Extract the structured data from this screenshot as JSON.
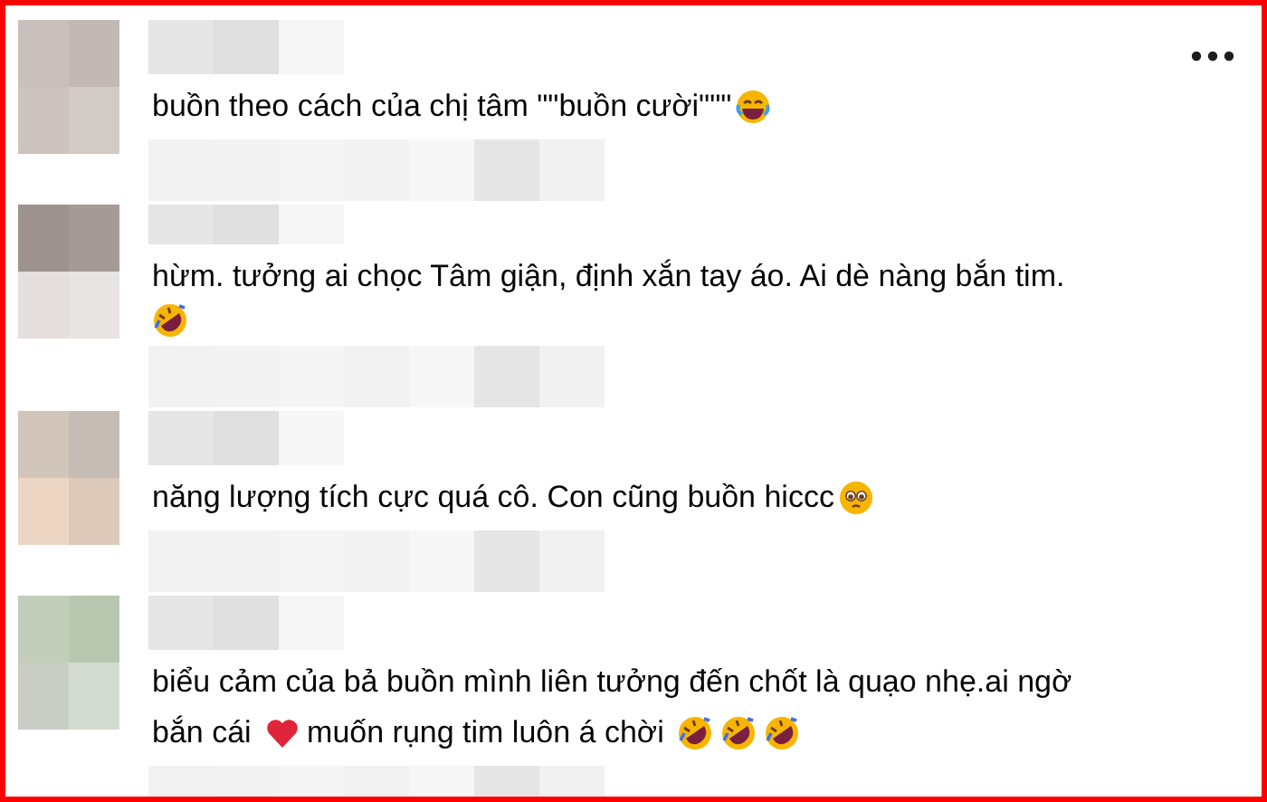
{
  "comments": [
    {
      "lines": [
        [
          {
            "kind": "text",
            "text": "buồn theo cách của chị tâm \"\"buồn cười\"\"\""
          },
          {
            "kind": "tears_of_joy"
          }
        ]
      ]
    },
    {
      "lines": [
        [
          {
            "kind": "text",
            "text": "hừm. tưởng ai chọc Tâm giận, định xắn tay áo. Ai dè nàng bắn tim."
          }
        ],
        [
          {
            "kind": "rofl"
          }
        ]
      ]
    },
    {
      "lines": [
        [
          {
            "kind": "text",
            "text": "năng lượng tích cực quá cô. Con cũng buồn hiccc"
          },
          {
            "kind": "pleading"
          }
        ]
      ]
    },
    {
      "lines": [
        [
          {
            "kind": "text",
            "text": "biểu cảm của bả buồn mình liên tưởng đến chốt là quạo nhẹ.ai ngờ"
          }
        ],
        [
          {
            "kind": "text",
            "text": "bắn cái "
          },
          {
            "kind": "heart"
          },
          {
            "kind": "text",
            "text": "muốn rụng tim luôn á chời "
          },
          {
            "kind": "rofl"
          },
          {
            "kind": "rofl"
          },
          {
            "kind": "rofl"
          }
        ]
      ]
    }
  ]
}
